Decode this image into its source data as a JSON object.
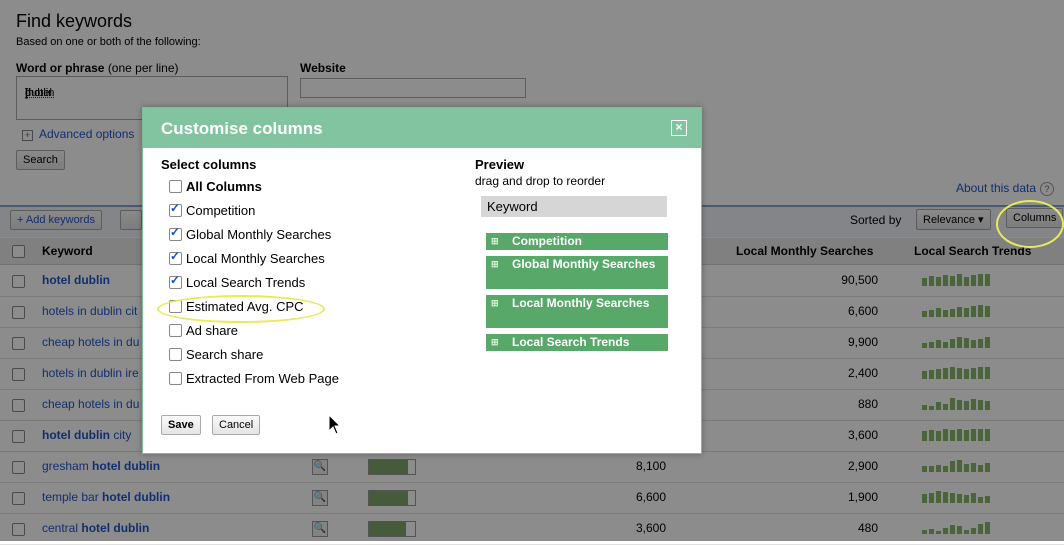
{
  "find": {
    "title": "Find keywords",
    "subtitle": "Based on one or both of the following:",
    "word_label": "Word or phrase",
    "word_hint": "(one per line)",
    "word_value_prefix": "[hotel ",
    "word_value_spell": "dublin",
    "word_value_suffix": "]",
    "website_label": "Website",
    "website_value": "",
    "advanced_options": "Advanced options",
    "search_button": "Search",
    "about_data": "About this data"
  },
  "toolbar": {
    "add_keywords": "+ Add keywords",
    "sorted_by": "Sorted by",
    "relevance": "Relevance ▾",
    "columns": "Columns"
  },
  "table": {
    "headers": {
      "keyword": "Keyword",
      "local_monthly": "Local Monthly Searches",
      "local_trends": "Local Search Trends"
    },
    "rows": [
      {
        "pre": "",
        "bold": "hotel dublin",
        "post": "",
        "global": "",
        "local": "90,500",
        "comp": 0.0,
        "trend": [
          8,
          10,
          9,
          11,
          10,
          12,
          9,
          11,
          12,
          12
        ]
      },
      {
        "pre": "hotels in dublin cit",
        "bold": "",
        "post": "",
        "global": "",
        "local": "6,600",
        "comp": 0.0,
        "trend": [
          6,
          7,
          9,
          7,
          8,
          10,
          9,
          11,
          12,
          11
        ]
      },
      {
        "pre": "cheap hotels in du",
        "bold": "",
        "post": "",
        "global": "",
        "local": "9,900",
        "comp": 0.0,
        "trend": [
          5,
          6,
          8,
          6,
          9,
          11,
          10,
          8,
          9,
          11
        ]
      },
      {
        "pre": "hotels in dublin ire",
        "bold": "",
        "post": "",
        "global": "",
        "local": "2,400",
        "comp": 0.0,
        "trend": [
          8,
          9,
          10,
          11,
          12,
          11,
          10,
          11,
          12,
          12
        ]
      },
      {
        "pre": "cheap hotels in du",
        "bold": "",
        "post": "",
        "global": "",
        "local": "880",
        "comp": 0.0,
        "trend": [
          5,
          4,
          8,
          6,
          12,
          10,
          9,
          11,
          10,
          9
        ]
      },
      {
        "pre": "",
        "bold": "hotel dublin",
        "post": " city",
        "global": "",
        "local": "3,600",
        "comp": 0.0,
        "trend": [
          10,
          11,
          10,
          12,
          11,
          12,
          11,
          12,
          12,
          12
        ]
      },
      {
        "pre": "gresham ",
        "bold": "hotel dublin",
        "post": "",
        "global": "8,100",
        "local": "2,900",
        "comp": 0.85,
        "trend": [
          6,
          6,
          7,
          6,
          11,
          12,
          8,
          9,
          7,
          9
        ]
      },
      {
        "pre": "temple bar ",
        "bold": "hotel dublin",
        "post": "",
        "global": "6,600",
        "local": "1,900",
        "comp": 0.85,
        "trend": [
          9,
          10,
          12,
          11,
          10,
          9,
          8,
          10,
          6,
          7
        ]
      },
      {
        "pre": "central ",
        "bold": "hotel dublin",
        "post": "",
        "global": "3,600",
        "local": "480",
        "comp": 0.8,
        "trend": [
          4,
          5,
          3,
          6,
          9,
          8,
          4,
          6,
          10,
          12
        ]
      }
    ]
  },
  "dialog": {
    "title": "Customise columns",
    "close": "×",
    "select_label": "Select columns",
    "columns": [
      {
        "label": "All Columns",
        "checked": false,
        "bold": true
      },
      {
        "label": "Competition",
        "checked": true,
        "bold": false
      },
      {
        "label": "Global Monthly Searches",
        "checked": true,
        "bold": false
      },
      {
        "label": "Local Monthly Searches",
        "checked": true,
        "bold": false
      },
      {
        "label": "Local Search Trends",
        "checked": true,
        "bold": false
      },
      {
        "label": "Estimated Avg. CPC",
        "checked": false,
        "bold": false
      },
      {
        "label": "Ad share",
        "checked": false,
        "bold": false
      },
      {
        "label": "Search share",
        "checked": false,
        "bold": false
      },
      {
        "label": "Extracted From Web Page",
        "checked": false,
        "bold": false
      }
    ],
    "preview_label": "Preview",
    "preview_hint": "drag and drop to reorder",
    "preview_keyword": "Keyword",
    "preview_items": [
      "Competition",
      "Global Monthly Searches",
      "Local Monthly Searches",
      "Local Search Trends"
    ],
    "save": "Save",
    "cancel": "Cancel"
  },
  "colors": {
    "dialog_header": "#82c3a0",
    "preview_item": "#58a86a",
    "link": "#2255cc",
    "highlight": "#e7ea5b"
  }
}
